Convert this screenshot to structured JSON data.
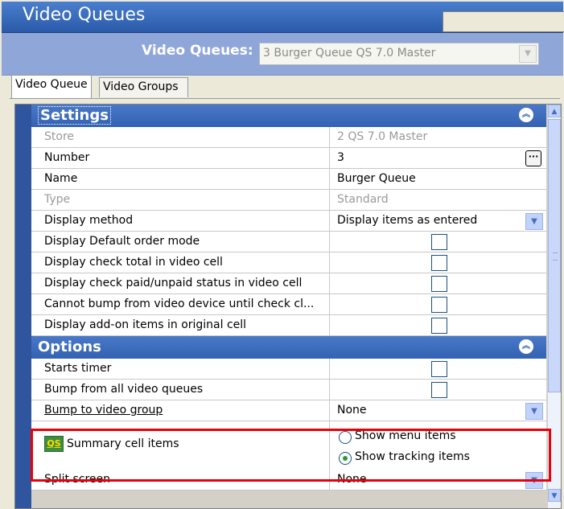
{
  "window": {
    "title": "Video Queues"
  },
  "selector": {
    "label": "Video Queues:",
    "value": "3 Burger Queue QS 7.0 Master"
  },
  "tabs": [
    {
      "label": "Video Queue",
      "active": true
    },
    {
      "label": "Video Groups",
      "active": false
    }
  ],
  "settings": {
    "header": "Settings",
    "rows": {
      "store": {
        "label": "Store",
        "value": "2  QS 7.0 Master"
      },
      "number": {
        "label": "Number",
        "value": "3"
      },
      "name": {
        "label": "Name",
        "value": "Burger Queue"
      },
      "type": {
        "label": "Type",
        "value": "Standard"
      },
      "display_method": {
        "label": "Display method",
        "value": "Display items as entered"
      },
      "default_order": {
        "label": "Display Default order mode"
      },
      "check_total": {
        "label": "Display check total in video cell"
      },
      "paid_status": {
        "label": "Display check paid/unpaid status in video cell"
      },
      "cannot_bump": {
        "label": "Cannot bump from video device until check cl..."
      },
      "addon_items": {
        "label": "Display add-on items in original cell"
      }
    }
  },
  "options": {
    "header": "Options",
    "rows": {
      "starts_timer": {
        "label": "Starts timer"
      },
      "bump_all": {
        "label": "Bump from all video queues"
      },
      "bump_group": {
        "label": "Bump to video group",
        "value": "None"
      },
      "summary": {
        "icon_text": "QS",
        "label": "Summary cell items",
        "option_menu": "Show menu items",
        "option_tracking": "Show tracking items",
        "selected": "Show tracking items"
      },
      "split_screen": {
        "label": "Split screen",
        "value": "None"
      }
    }
  },
  "icons": {
    "collapse": "double-chevron-up-icon",
    "dropdown": "chevron-down-icon",
    "ellipsis": "ellipsis-icon"
  },
  "colors": {
    "title_bar": "#2a5aa8",
    "category_bar": "#3462b3",
    "highlight": "#e8000b"
  }
}
